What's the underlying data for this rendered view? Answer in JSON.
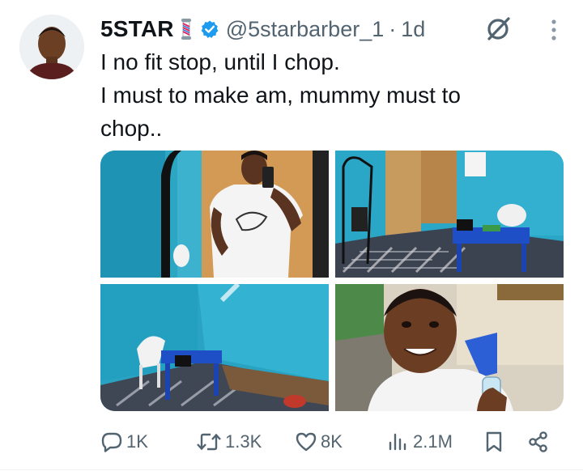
{
  "author": {
    "name": "5STAR",
    "handle": "@5starbarber_1",
    "separator": "·",
    "time": "1d"
  },
  "tweet": {
    "lines": [
      "I no fit stop, until I chop.",
      "I must to make am, mummy must to",
      "chop.."
    ]
  },
  "icons": {
    "barber_pole": "barber-pole-icon",
    "verified": "verified-badge-icon",
    "grok": "grok-icon",
    "more": "more-icon"
  },
  "colors": {
    "verified": "#1d9bf0",
    "text_secondary": "#536471",
    "text_primary": "#0f1419"
  },
  "actions": {
    "replies": "1K",
    "reposts": "1.3K",
    "likes": "8K",
    "views": "2.1M"
  }
}
